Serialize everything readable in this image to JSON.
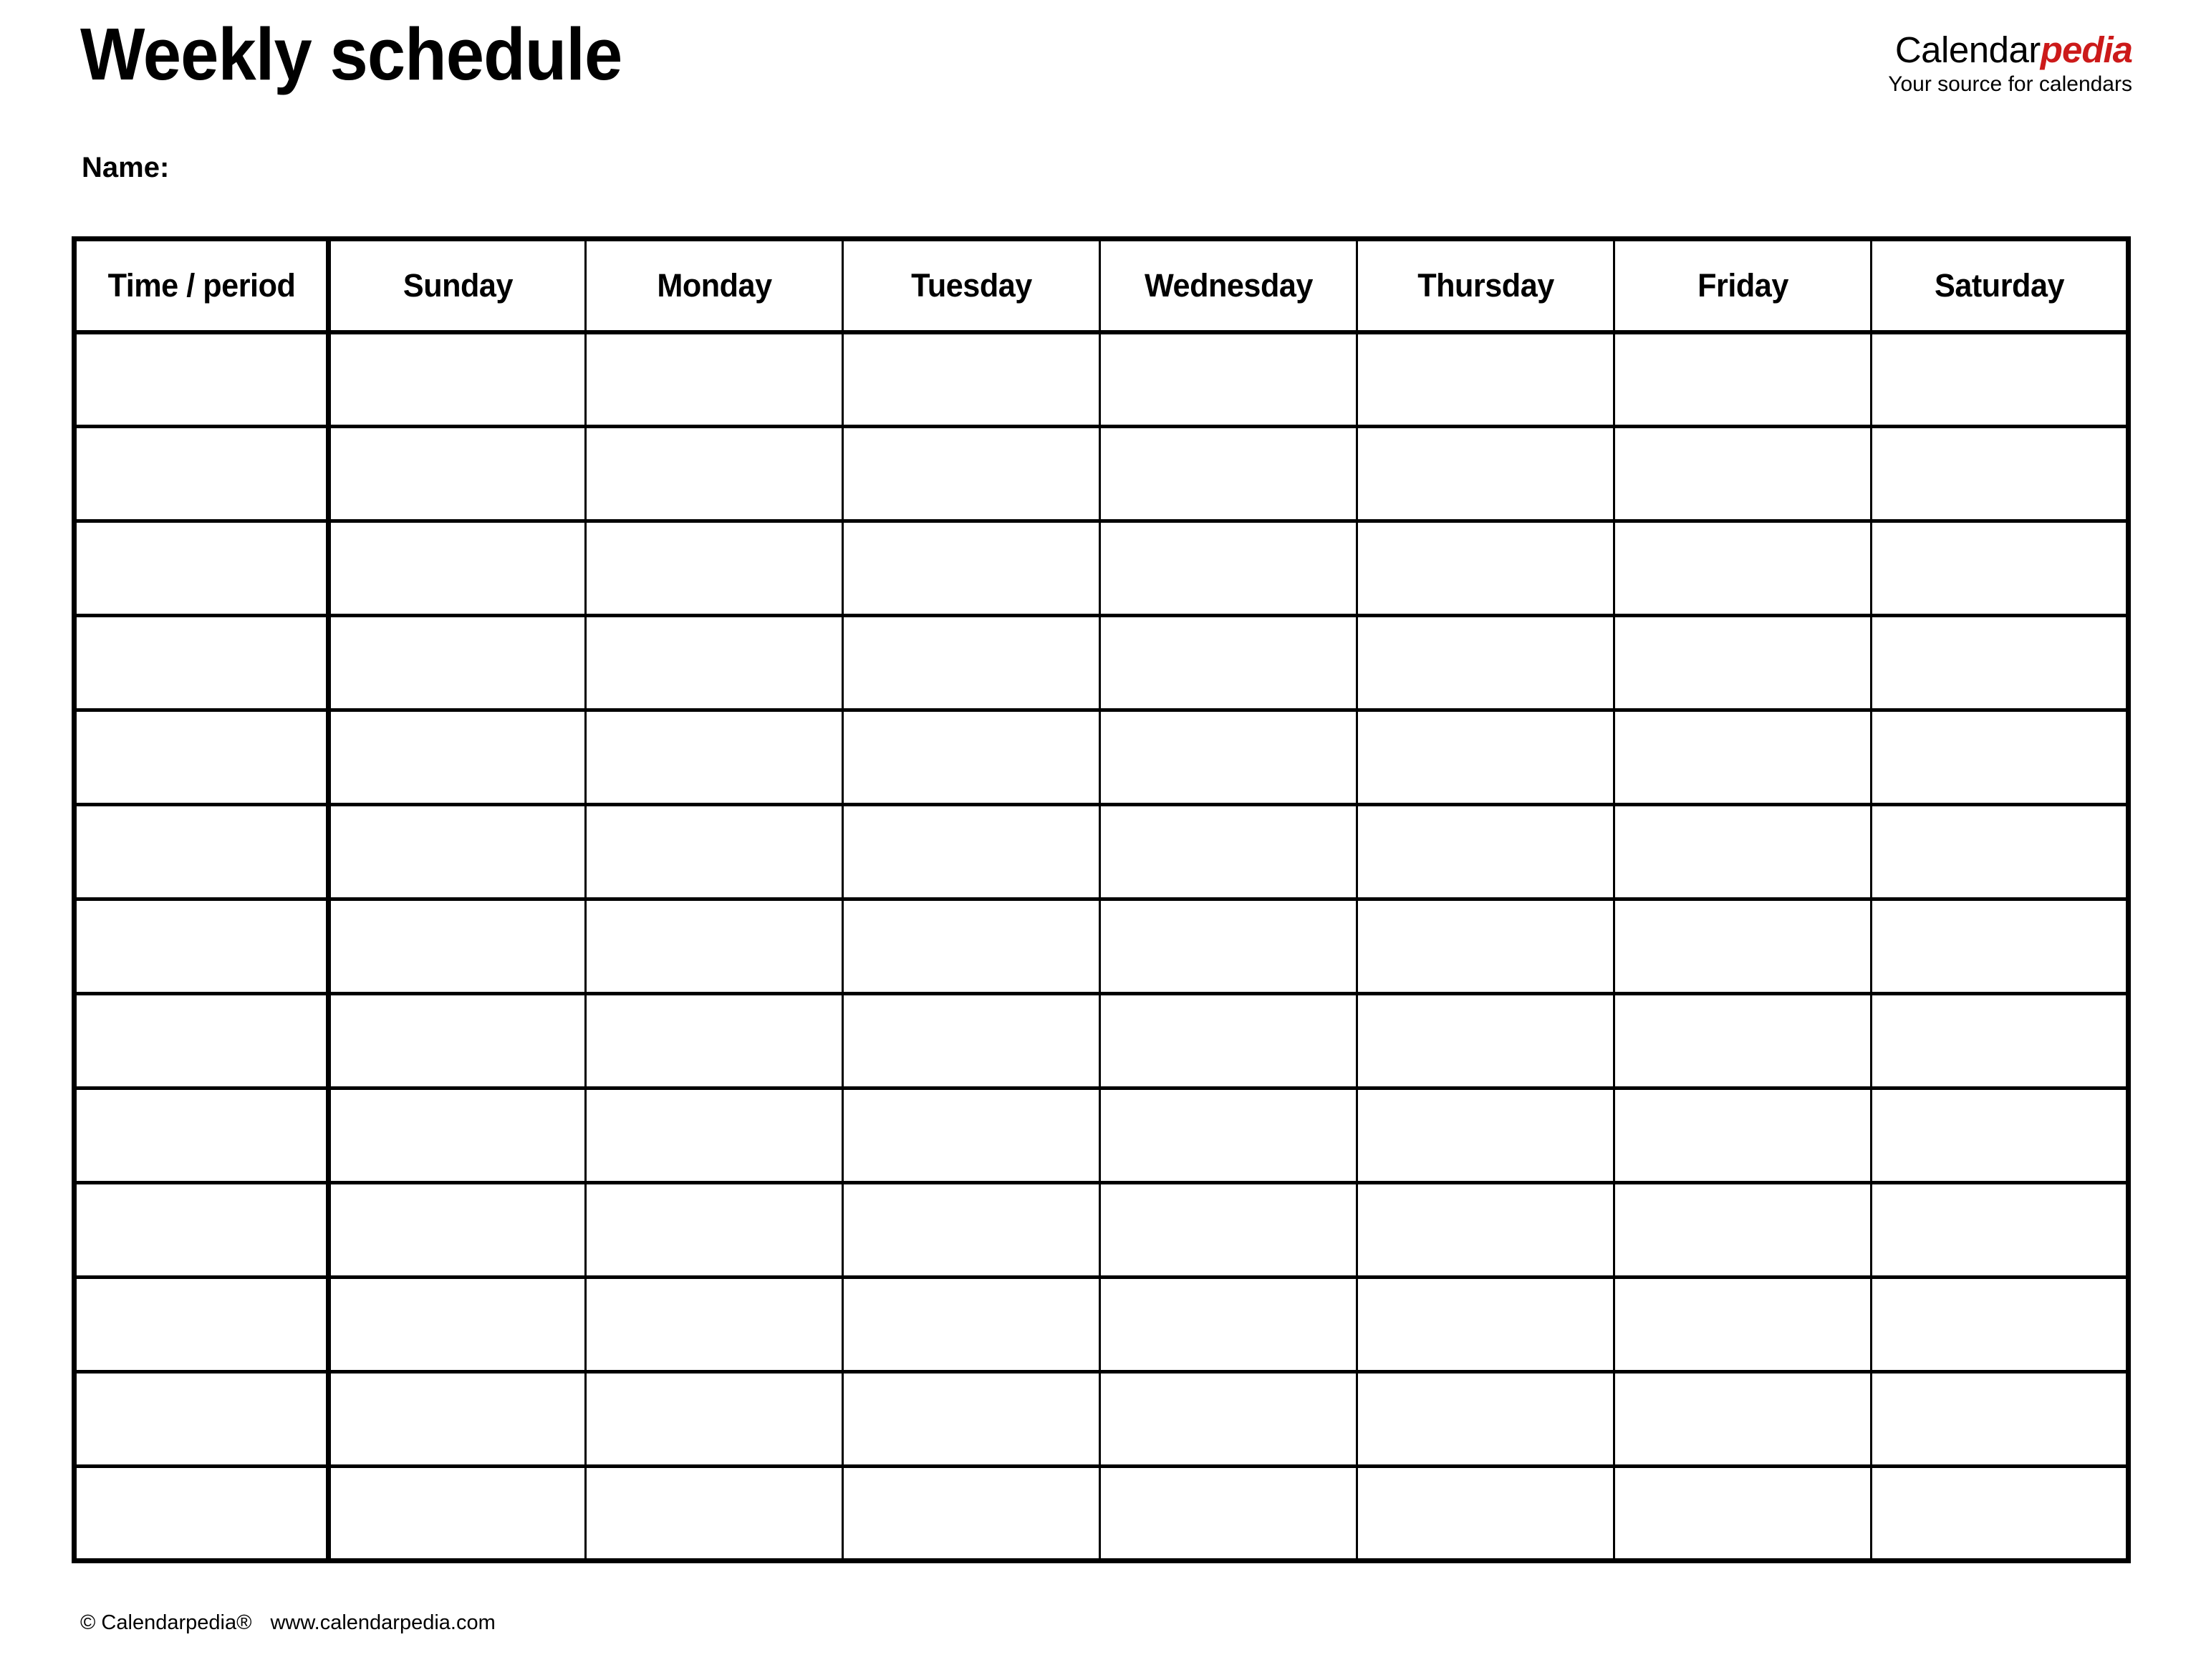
{
  "document": {
    "title": "Weekly schedule",
    "name_label": "Name:"
  },
  "brand": {
    "name_part_1": "Calendar",
    "name_part_2": "pedia",
    "tagline": "Your source for calendars",
    "accent_color": "#CC1A1A",
    "text_color": "#000000"
  },
  "table": {
    "headers": [
      "Time / period",
      "Sunday",
      "Monday",
      "Tuesday",
      "Wednesday",
      "Thursday",
      "Friday",
      "Saturday"
    ],
    "row_count": 13,
    "column_count": 8,
    "rows": [
      [
        "",
        "",
        "",
        "",
        "",
        "",
        "",
        ""
      ],
      [
        "",
        "",
        "",
        "",
        "",
        "",
        "",
        ""
      ],
      [
        "",
        "",
        "",
        "",
        "",
        "",
        "",
        ""
      ],
      [
        "",
        "",
        "",
        "",
        "",
        "",
        "",
        ""
      ],
      [
        "",
        "",
        "",
        "",
        "",
        "",
        "",
        ""
      ],
      [
        "",
        "",
        "",
        "",
        "",
        "",
        "",
        ""
      ],
      [
        "",
        "",
        "",
        "",
        "",
        "",
        "",
        ""
      ],
      [
        "",
        "",
        "",
        "",
        "",
        "",
        "",
        ""
      ],
      [
        "",
        "",
        "",
        "",
        "",
        "",
        "",
        ""
      ],
      [
        "",
        "",
        "",
        "",
        "",
        "",
        "",
        ""
      ],
      [
        "",
        "",
        "",
        "",
        "",
        "",
        "",
        ""
      ],
      [
        "",
        "",
        "",
        "",
        "",
        "",
        "",
        ""
      ],
      [
        "",
        "",
        "",
        "",
        "",
        "",
        "",
        ""
      ]
    ]
  },
  "footer": {
    "copyright": "© Calendarpedia®",
    "website": "www.calendarpedia.com"
  }
}
